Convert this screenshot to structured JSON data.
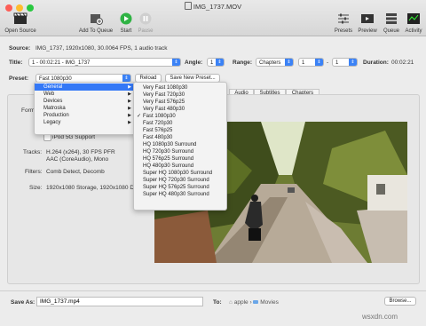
{
  "window": {
    "title": "IMG_1737.MOV"
  },
  "toolbar": {
    "open_source": "Open Source",
    "add_to_queue": "Add To Queue",
    "start": "Start",
    "pause": "Pause",
    "presets": "Presets",
    "preview": "Preview",
    "queue": "Queue",
    "activity": "Activity"
  },
  "source": {
    "label": "Source:",
    "value": "IMG_1737, 1920x1080, 30.0064 FPS, 1 audio track"
  },
  "title_row": {
    "title_label": "Title:",
    "title_value": "1 - 00:02:21 - IMG_1737",
    "angle_label": "Angle:",
    "angle_value": "1",
    "range_label": "Range:",
    "range_value": "Chapters",
    "range_start": "1",
    "range_sep": "-",
    "range_end": "1",
    "duration_label": "Duration:",
    "duration_value": "00:02:21"
  },
  "preset_row": {
    "label": "Preset:",
    "value": "Fast 1080p30",
    "reload": "Reload",
    "save_new": "Save New Preset..."
  },
  "tabs": [
    "Audio",
    "Subtitles",
    "Chapters"
  ],
  "summary": {
    "format_label": "Form",
    "ipod": "iPod 5G Support",
    "tracks_label": "Tracks:",
    "tracks_line1": "H.264 (x264), 30 FPS PFR",
    "tracks_line2": "AAC (CoreAudio), Mono",
    "filters_label": "Filters:",
    "filters_value": "Comb Detect, Decomb",
    "size_label": "Size:",
    "size_value": "1920x1080 Storage, 1920x1080 Di"
  },
  "category_menu": [
    {
      "label": "General",
      "selected": true
    },
    {
      "label": "Web"
    },
    {
      "label": "Devices"
    },
    {
      "label": "Matroska"
    },
    {
      "label": "Production"
    },
    {
      "label": "Legacy"
    }
  ],
  "preset_menu": [
    {
      "label": "Very Fast 1080p30"
    },
    {
      "label": "Very Fast 720p30"
    },
    {
      "label": "Very Fast 576p25"
    },
    {
      "label": "Very Fast 480p30"
    },
    {
      "label": "Fast 1080p30",
      "checked": true
    },
    {
      "label": "Fast 720p30"
    },
    {
      "label": "Fast 576p25"
    },
    {
      "label": "Fast 480p30"
    },
    {
      "label": "HQ 1080p30 Surround"
    },
    {
      "label": "HQ 720p30 Surround"
    },
    {
      "label": "HQ 576p25 Surround"
    },
    {
      "label": "HQ 480p30 Surround"
    },
    {
      "label": "Super HQ 1080p30 Surround"
    },
    {
      "label": "Super HQ 720p30 Surround"
    },
    {
      "label": "Super HQ 576p25 Surround"
    },
    {
      "label": "Super HQ 480p30 Surround"
    }
  ],
  "save": {
    "label": "Save As:",
    "filename": "IMG_1737.mp4",
    "to_label": "To:",
    "path_user": "apple",
    "path_sep": "›",
    "path_folder": "Movies",
    "browse": "Browse..."
  },
  "watermark": "wsxdn.com",
  "colors": {
    "accent": "#3478f6",
    "start_green": "#2fb344"
  }
}
